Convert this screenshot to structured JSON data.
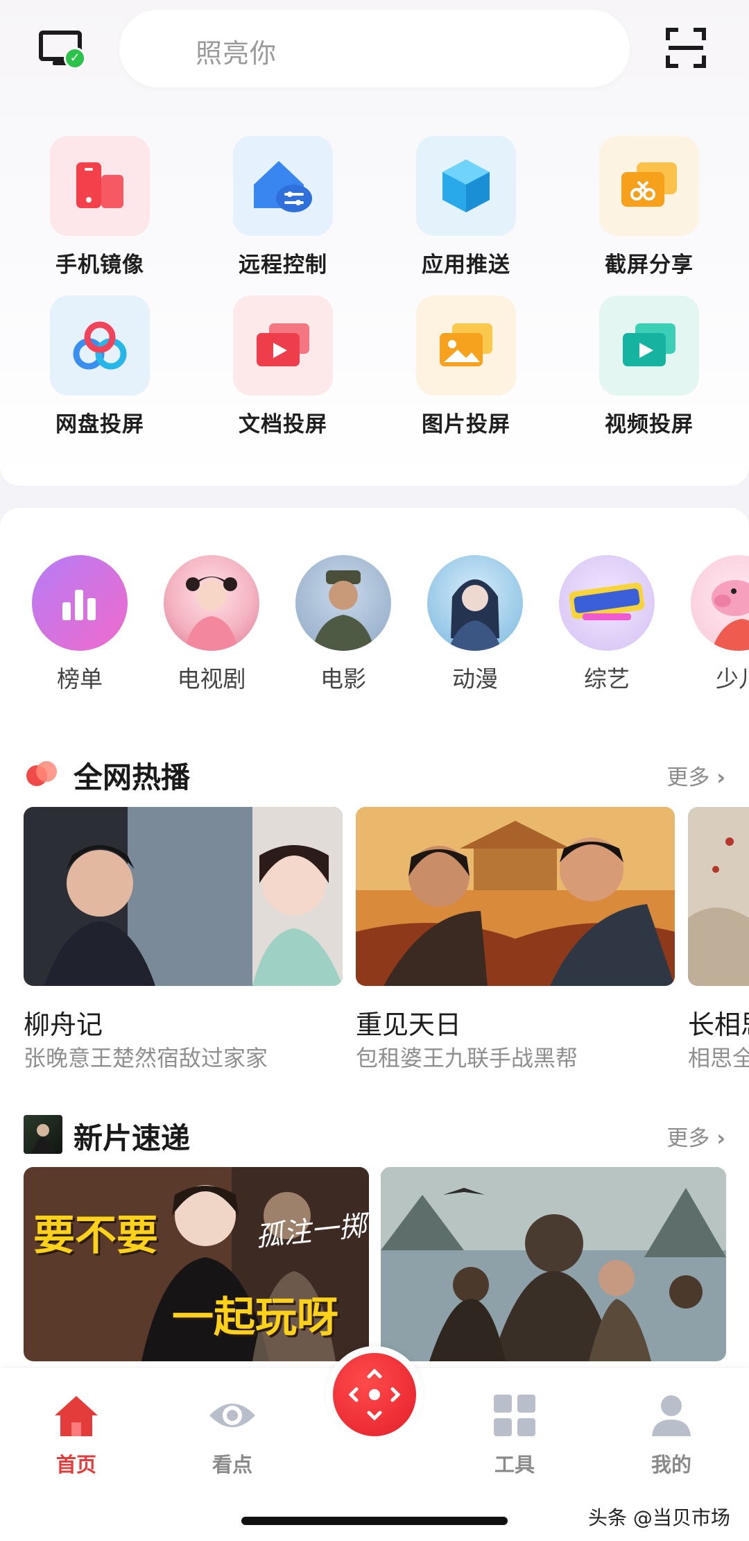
{
  "header": {
    "search_placeholder": "照亮你"
  },
  "features": [
    {
      "label": "手机镜像",
      "icon": "phone-mirror-icon"
    },
    {
      "label": "远程控制",
      "icon": "remote-control-icon"
    },
    {
      "label": "应用推送",
      "icon": "app-push-icon"
    },
    {
      "label": "截屏分享",
      "icon": "screenshot-share-icon"
    },
    {
      "label": "网盘投屏",
      "icon": "cloud-drive-icon"
    },
    {
      "label": "文档投屏",
      "icon": "document-cast-icon"
    },
    {
      "label": "图片投屏",
      "icon": "image-cast-icon"
    },
    {
      "label": "视频投屏",
      "icon": "video-cast-icon"
    }
  ],
  "categories": [
    {
      "label": "榜单"
    },
    {
      "label": "电视剧"
    },
    {
      "label": "电影"
    },
    {
      "label": "动漫"
    },
    {
      "label": "综艺"
    },
    {
      "label": "少儿"
    }
  ],
  "hot_section": {
    "title": "全网热播",
    "more": "更多",
    "items": [
      {
        "title": "柳舟记",
        "subtitle": "张晚意王楚然宿敌过家家"
      },
      {
        "title": "重见天日",
        "subtitle": "包租婆王九联手战黑帮"
      },
      {
        "title": "长相思",
        "subtitle": "相思全"
      }
    ]
  },
  "new_section": {
    "title": "新片速递",
    "more": "更多",
    "poster1_text_line1": "要不要",
    "poster1_text_line2": "一起玩呀",
    "poster1_calligraphy": "孤注一掷"
  },
  "bottom_nav": [
    {
      "label": "首页",
      "active": true
    },
    {
      "label": "看点",
      "active": false
    },
    {
      "label": "工具",
      "active": false
    },
    {
      "label": "我的",
      "active": false
    }
  ],
  "watermark": "头条 @当贝市场",
  "colors": {
    "accent": "#e43b3b",
    "nav_inactive": "#8a8a8a"
  }
}
